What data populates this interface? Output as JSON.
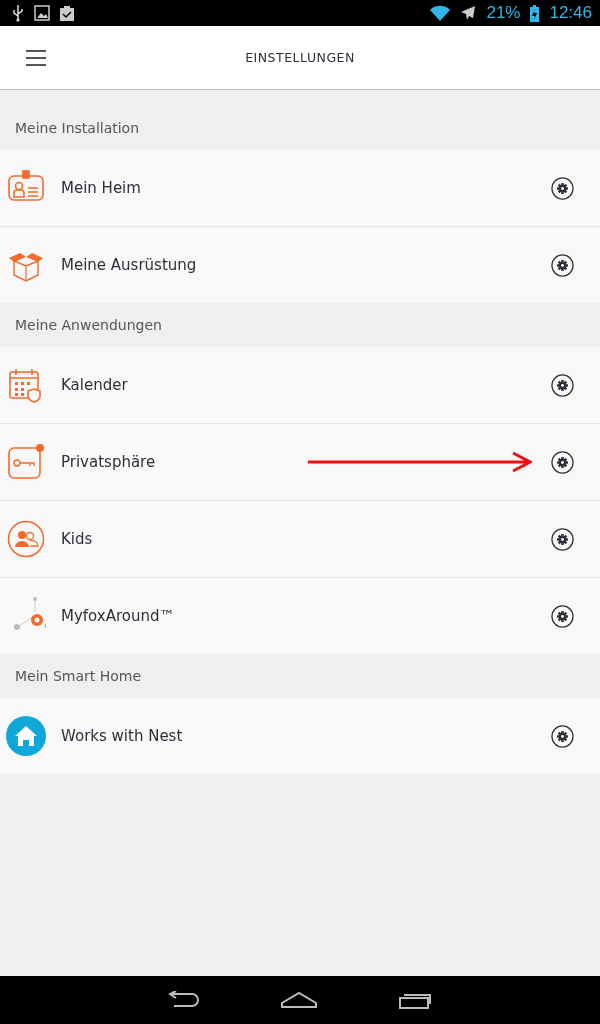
{
  "status_bar": {
    "battery": "21%",
    "time": "12:46"
  },
  "header": {
    "title": "EINSTELLUNGEN"
  },
  "sections": [
    {
      "title": "Meine Installation",
      "items": [
        {
          "label": "Mein Heim",
          "kind": "id-card",
          "arrow": false
        },
        {
          "label": "Meine Ausrüstung",
          "kind": "box",
          "arrow": false
        }
      ]
    },
    {
      "title": "Meine Anwendungen",
      "items": [
        {
          "label": "Kalender",
          "kind": "calendar",
          "arrow": false
        },
        {
          "label": "Privatsphäre",
          "kind": "key",
          "arrow": true
        },
        {
          "label": "Kids",
          "kind": "kids",
          "arrow": false
        },
        {
          "label": "MyfoxAround™",
          "kind": "around",
          "arrow": false
        }
      ]
    },
    {
      "title": "Mein Smart Home",
      "items": [
        {
          "label": "Works with Nest",
          "kind": "nest",
          "arrow": false
        }
      ]
    }
  ]
}
